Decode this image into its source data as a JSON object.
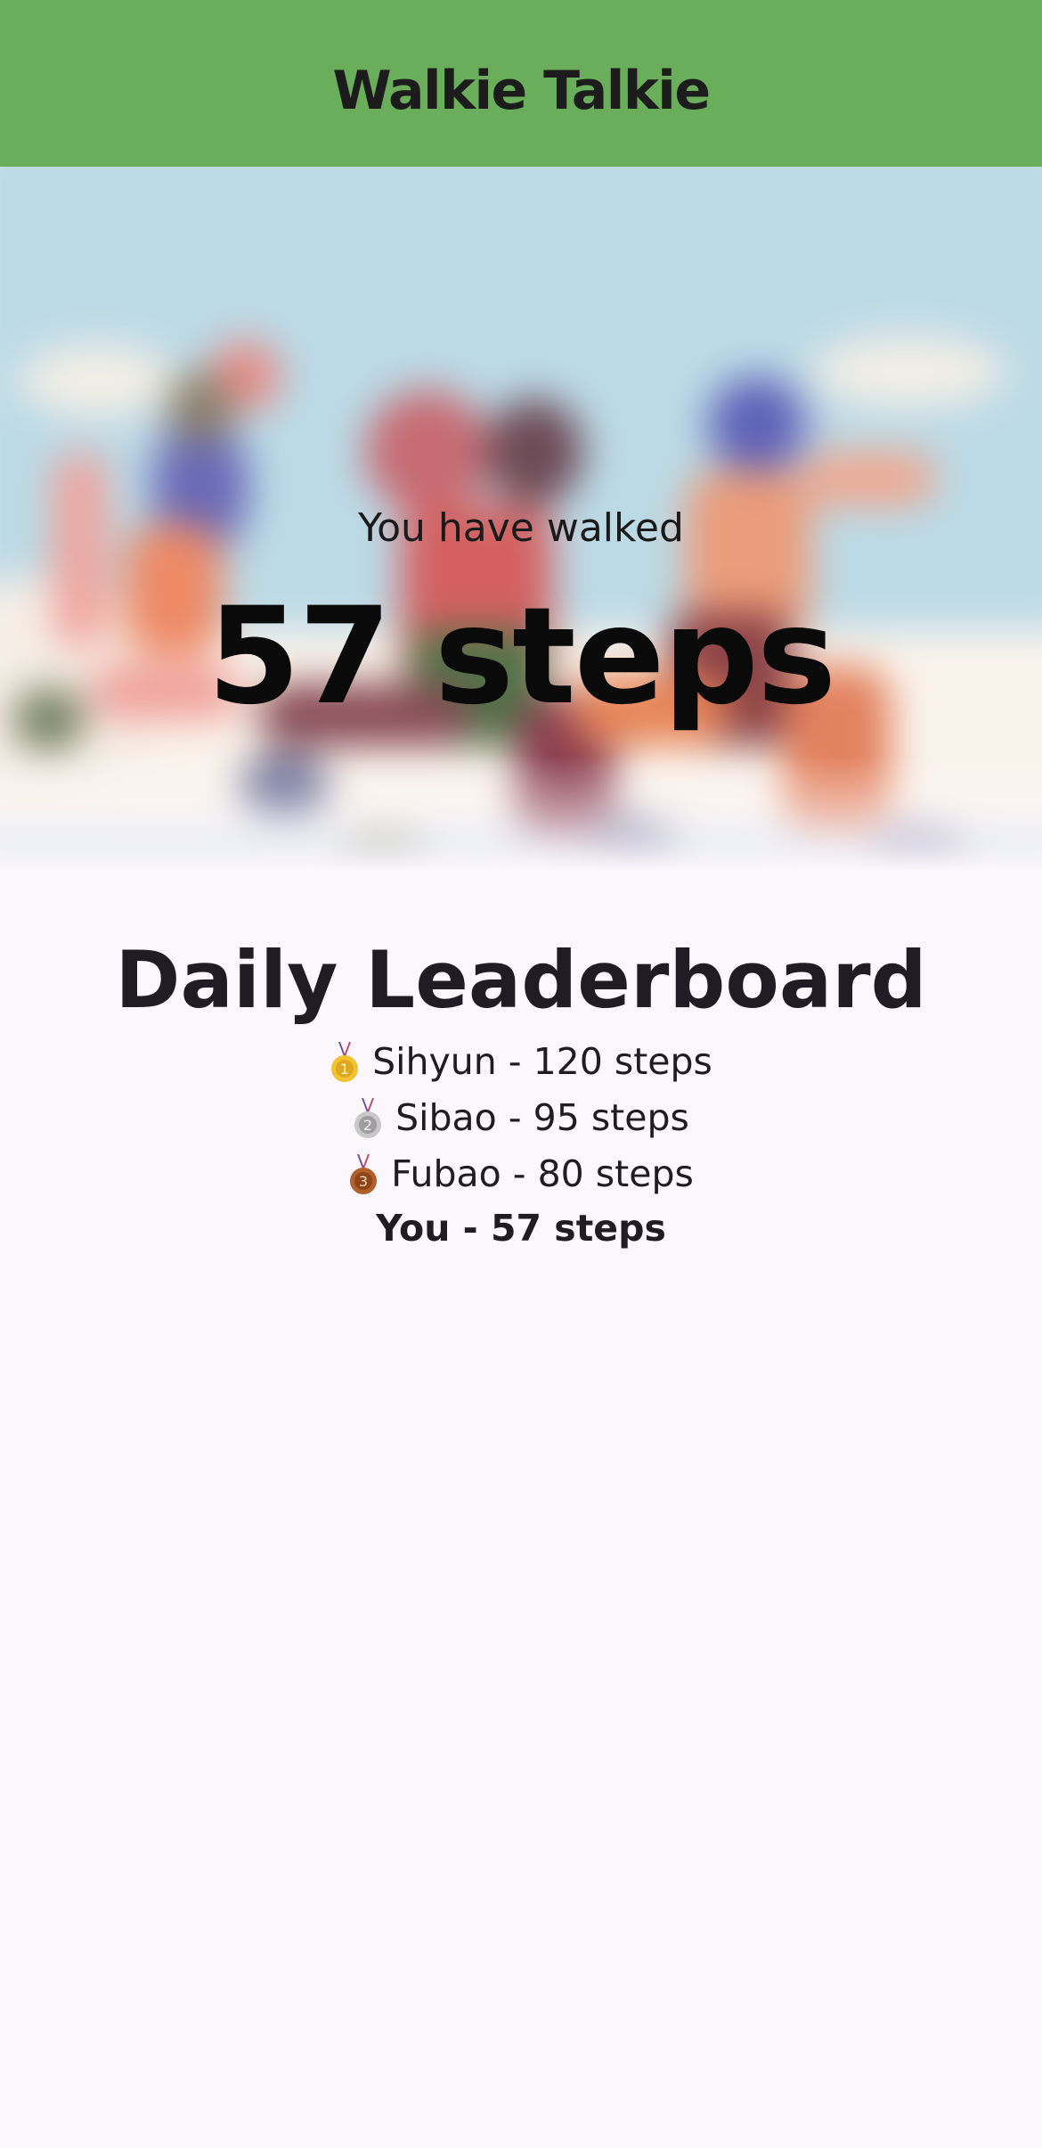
{
  "app": {
    "title": "Walkie Talkie",
    "bar_color": "#6aae5b"
  },
  "hero": {
    "caption": "You have walked",
    "steps_text": "57 steps",
    "background_art": "blurred-runners-illustration"
  },
  "leaderboard": {
    "title": "Daily Leaderboard",
    "entries": [
      {
        "medal": "gold-medal-icon",
        "text": "Sihyun - 120 steps"
      },
      {
        "medal": "silver-medal-icon",
        "text": "Sibao - 95 steps"
      },
      {
        "medal": "bronze-medal-icon",
        "text": "Fubao - 80 steps"
      }
    ],
    "you_text": "You - 57 steps"
  },
  "colors": {
    "page_bg": "#fcf7fc",
    "gold": "#f2c230",
    "silver": "#b5b5b5",
    "bronze": "#b0602a",
    "ribbon": "#6d4aa0"
  }
}
